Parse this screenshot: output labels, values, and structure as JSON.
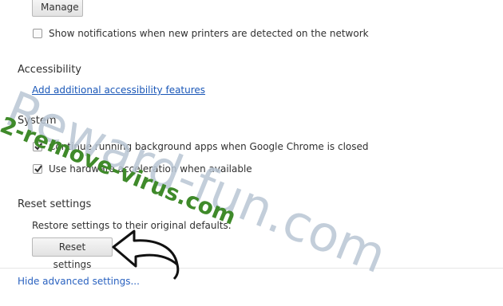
{
  "printers": {
    "manage_button": "Manage",
    "notify_label": "Show notifications when new printers are detected on the network",
    "notify_checked": false
  },
  "accessibility": {
    "heading": "Accessibility",
    "link": "Add additional accessibility features"
  },
  "system": {
    "heading": "System",
    "background_apps_label": "Continue running background apps when Google Chrome is closed",
    "background_apps_checked": true,
    "hw_accel_label": "Use hardware acceleration when available",
    "hw_accel_checked": true
  },
  "reset": {
    "heading": "Reset settings",
    "description": "Restore settings to their original defaults.",
    "button": "Reset settings"
  },
  "footer": {
    "hide_advanced_link": "Hide advanced settings..."
  },
  "watermarks": {
    "large": "Reward-fun.com",
    "small": "2-remove-virus.com"
  },
  "colors": {
    "link": "#1a57b8",
    "watermark_large": "#b9c6d4",
    "watermark_small": "#3f8a2a"
  }
}
